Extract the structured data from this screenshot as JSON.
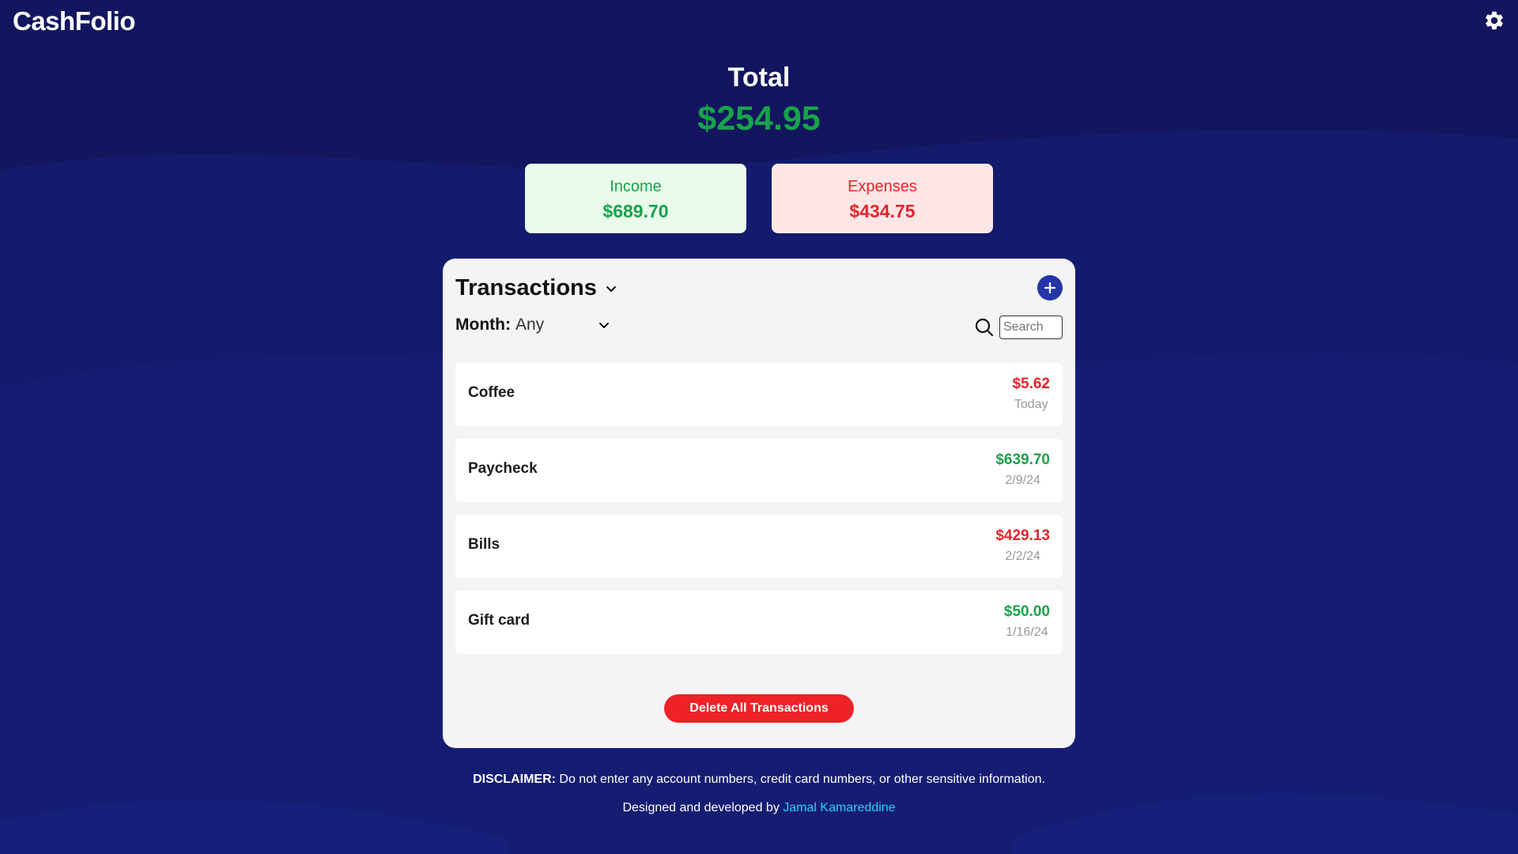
{
  "app": {
    "title": "CashFolio"
  },
  "summary": {
    "total_label": "Total",
    "total_value": "$254.95",
    "income_label": "Income",
    "income_value": "$689.70",
    "expenses_label": "Expenses",
    "expenses_value": "$434.75"
  },
  "transactions": {
    "title": "Transactions",
    "month_label": "Month:",
    "month_value": "Any",
    "search_placeholder": "Search",
    "items": [
      {
        "name": "Coffee",
        "amount": "$5.62",
        "date": "Today",
        "type": "expense"
      },
      {
        "name": "Paycheck",
        "amount": "$639.70",
        "date": "2/9/24",
        "type": "income"
      },
      {
        "name": "Bills",
        "amount": "$429.13",
        "date": "2/2/24",
        "type": "expense"
      },
      {
        "name": "Gift card",
        "amount": "$50.00",
        "date": "1/16/24",
        "type": "income"
      }
    ],
    "delete_all_label": "Delete All Transactions"
  },
  "footer": {
    "disclaimer_label": "DISCLAIMER:",
    "disclaimer_text": "Do not enter any account numbers, credit card numbers, or other sensitive information.",
    "credit_text": "Designed and developed by",
    "credit_link": "Jamal Kamareddine"
  },
  "colors": {
    "background": "#141a62",
    "income": "#17a34a",
    "expense": "#e5242b",
    "accent": "#2435a5",
    "link": "#27d3f0"
  },
  "icons": {
    "settings": "gear-icon",
    "add": "plus-icon",
    "expand": "chevron-down-icon",
    "search": "search-icon"
  }
}
